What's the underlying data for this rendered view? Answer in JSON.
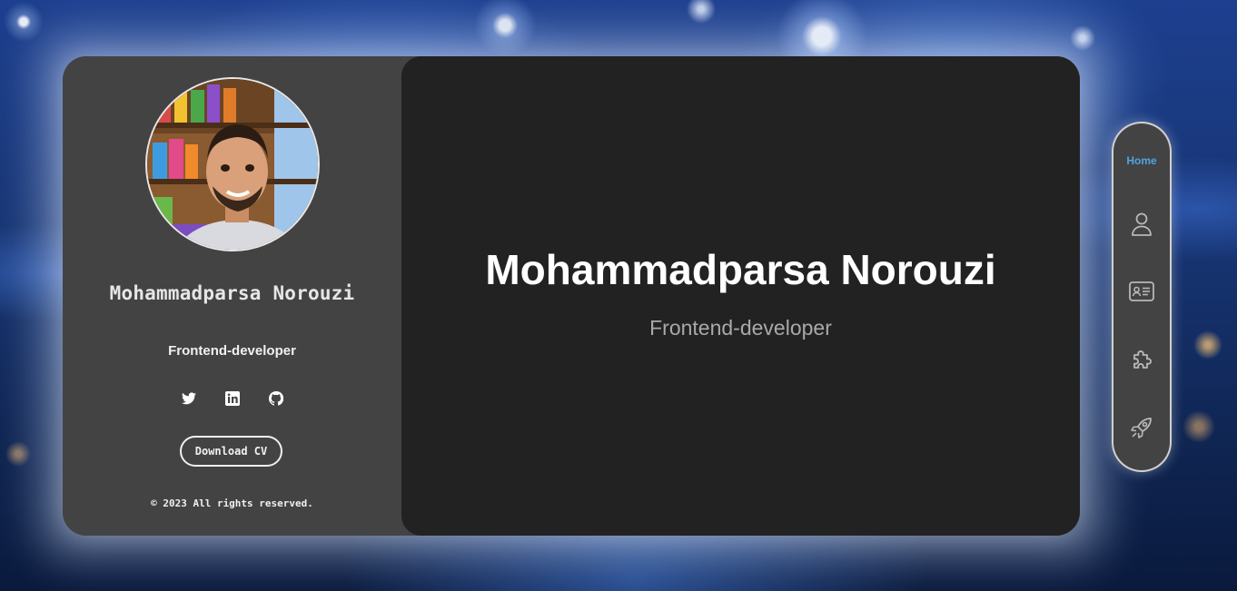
{
  "profile": {
    "name": "Mohammadparsa Norouzi",
    "role": "Frontend-developer"
  },
  "sidebar": {
    "socials": [
      "twitter-icon",
      "linkedin-icon",
      "github-icon"
    ],
    "cv_button": "Download CV",
    "copyright": "© 2023 All rights reserved."
  },
  "main": {
    "title": "Mohammadparsa Norouzi",
    "subtitle": "Frontend-developer"
  },
  "nav": {
    "active": "Home",
    "items": [
      {
        "label": "Home",
        "icon": "home-label"
      },
      {
        "icon": "user-icon"
      },
      {
        "icon": "id-card-icon"
      },
      {
        "icon": "puzzle-icon"
      },
      {
        "icon": "rocket-icon"
      }
    ]
  },
  "colors": {
    "card": "#434343",
    "main": "#222222",
    "accent": "#4fa3e3"
  }
}
